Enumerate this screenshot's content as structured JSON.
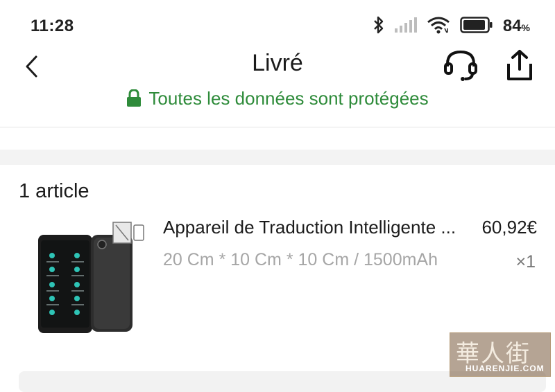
{
  "status_bar": {
    "time": "11:28",
    "battery_percent": "84",
    "battery_unit": "%",
    "icons": [
      "bluetooth-icon",
      "signal-icon",
      "wifi-icon",
      "battery-icon"
    ]
  },
  "header": {
    "title": "Livré",
    "back_icon": "chevron-left-icon",
    "support_icon": "headset-icon",
    "share_icon": "share-icon"
  },
  "security": {
    "text": "Toutes les données sont protégées",
    "icon": "lock-icon",
    "color": "#2e8b3a"
  },
  "order": {
    "items_count_label": "1 article",
    "items": [
      {
        "name": "Appareil de Traduction Intelligente ...",
        "price": "60,92€",
        "variant": "20 Cm * 10 Cm * 10 Cm / 1500mAh",
        "quantity": "×1"
      }
    ]
  },
  "watermark": {
    "text": "華人街",
    "subtext": "HUARENJIE.COM"
  }
}
